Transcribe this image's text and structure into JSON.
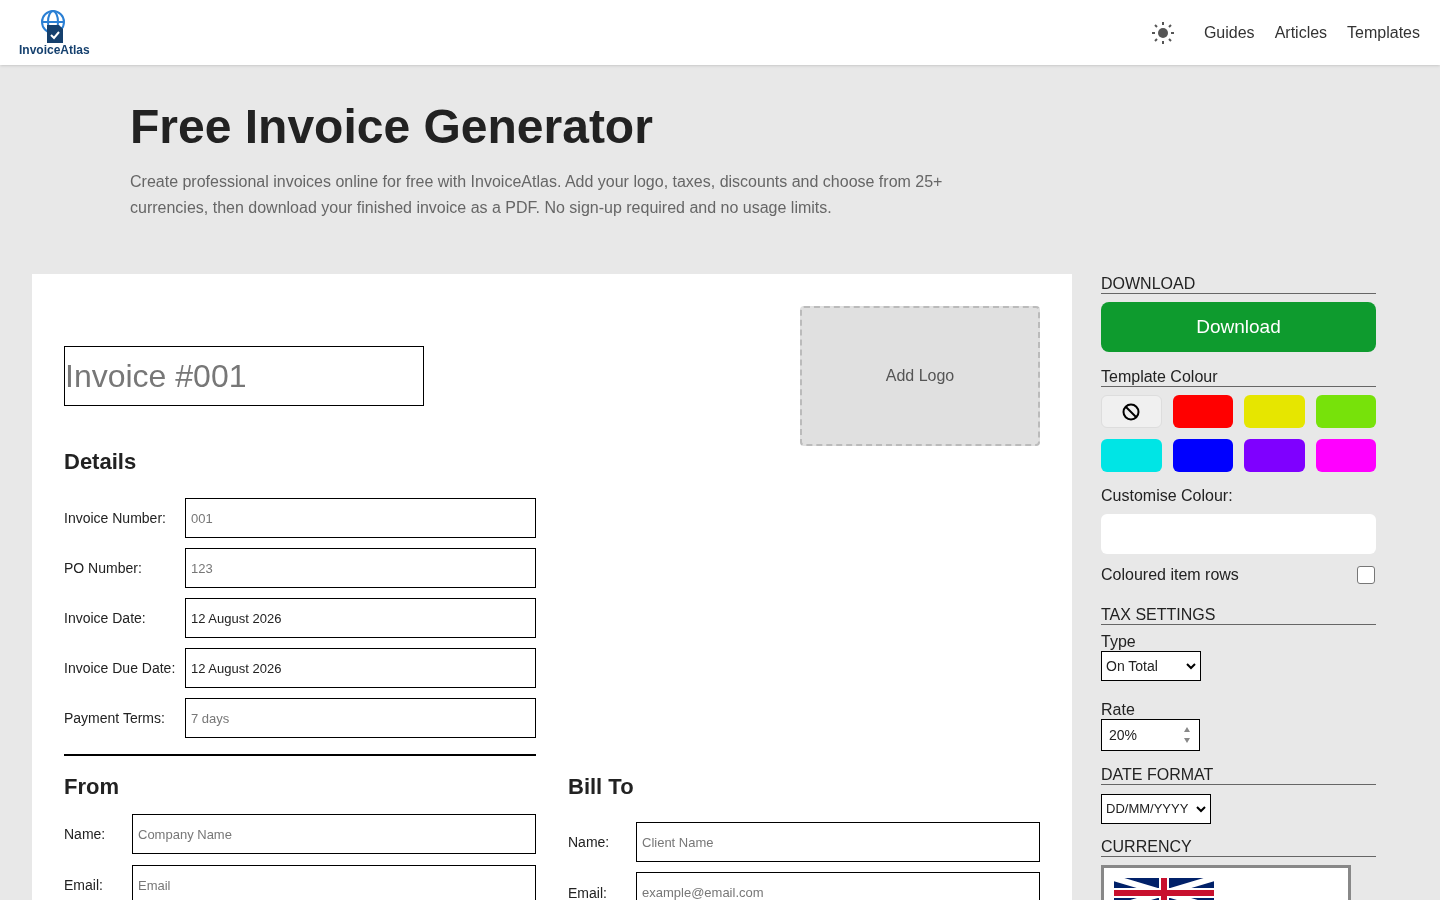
{
  "header": {
    "logo_text": "InvoiceAtlas",
    "nav": [
      "Guides",
      "Articles",
      "Templates"
    ]
  },
  "hero": {
    "title": "Free Invoice Generator",
    "description": "Create professional invoices online for free with InvoiceAtlas. Add your logo, taxes, discounts and choose from 25+ currencies, then download your finished invoice as a PDF. No sign-up required and no usage limits."
  },
  "invoice": {
    "title_placeholder": "Invoice #001",
    "logo_label": "Add Logo",
    "details_heading": "Details",
    "details": [
      {
        "label": "Invoice Number:",
        "placeholder": "001"
      },
      {
        "label": "PO Number:",
        "placeholder": "123"
      },
      {
        "label": "Invoice Date:",
        "value": "12 August 2026"
      },
      {
        "label": "Invoice Due Date:",
        "value": "12 August 2026"
      },
      {
        "label": "Payment Terms:",
        "placeholder": "7 days"
      }
    ],
    "from": {
      "heading": "From",
      "fields": [
        {
          "label": "Name:",
          "placeholder": "Company Name"
        },
        {
          "label": "Email:",
          "placeholder": "Email"
        }
      ]
    },
    "bill_to": {
      "heading": "Bill To",
      "fields": [
        {
          "label": "Name:",
          "placeholder": "Client Name"
        },
        {
          "label": "Email:",
          "placeholder": "example@email.com"
        }
      ]
    }
  },
  "sidebar": {
    "download_heading": "DOWNLOAD",
    "download_button": "Download",
    "template_colour_heading": "Template Colour",
    "swatches": [
      {
        "kind": "none"
      },
      {
        "kind": "color",
        "color": "#ff0000"
      },
      {
        "kind": "color",
        "color": "#e6e600"
      },
      {
        "kind": "color",
        "color": "#77e20a"
      },
      {
        "kind": "color",
        "color": "#00e5e5"
      },
      {
        "kind": "color",
        "color": "#0000ff"
      },
      {
        "kind": "color",
        "color": "#7f00ff"
      },
      {
        "kind": "color",
        "color": "#ff00ff"
      }
    ],
    "customise_label": "Customise Colour:",
    "coloured_rows": {
      "label": "Coloured item rows",
      "checked": false
    },
    "tax_heading": "TAX SETTINGS",
    "type_label": "Type",
    "type_value": "On Total",
    "rate_label": "Rate",
    "rate_value": "20%",
    "date_heading": "DATE FORMAT",
    "date_value": "DD/MM/YYYY",
    "currency_heading": "CURRENCY"
  }
}
